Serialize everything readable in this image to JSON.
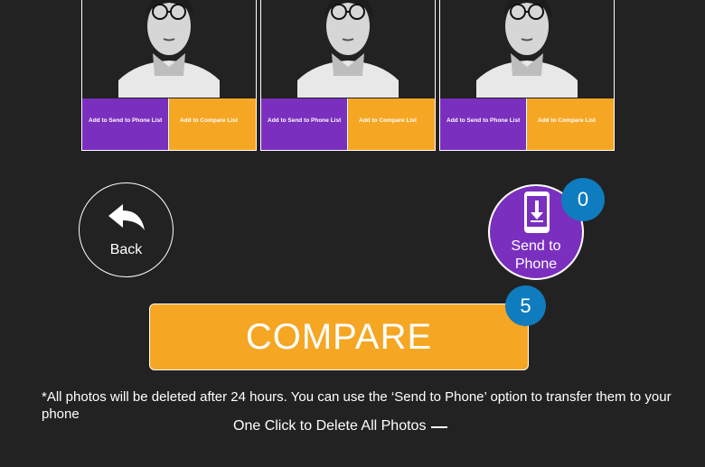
{
  "photos": [
    {
      "send_label": "Add to Send to Phone List",
      "compare_label": "Add to Compare List"
    },
    {
      "send_label": "Add to Send to Phone List",
      "compare_label": "Add to Compare List"
    },
    {
      "send_label": "Add to Send to Phone List",
      "compare_label": "Add to Compare List"
    }
  ],
  "back": {
    "label": "Back"
  },
  "send_to_phone": {
    "label_line1": "Send to",
    "label_line2": "Phone",
    "count": "0"
  },
  "compare": {
    "label": "COMPARE",
    "count": "5"
  },
  "notice": "*All photos will be deleted after 24 hours. You can use the ‘Send to Phone’ option to transfer them to your phone",
  "delete_all": {
    "label": "One Click to Delete All Photos"
  },
  "colors": {
    "background": "#222222",
    "purple": "#7b2fbe",
    "orange": "#f5a623",
    "badge_blue": "#0e7cbf"
  }
}
